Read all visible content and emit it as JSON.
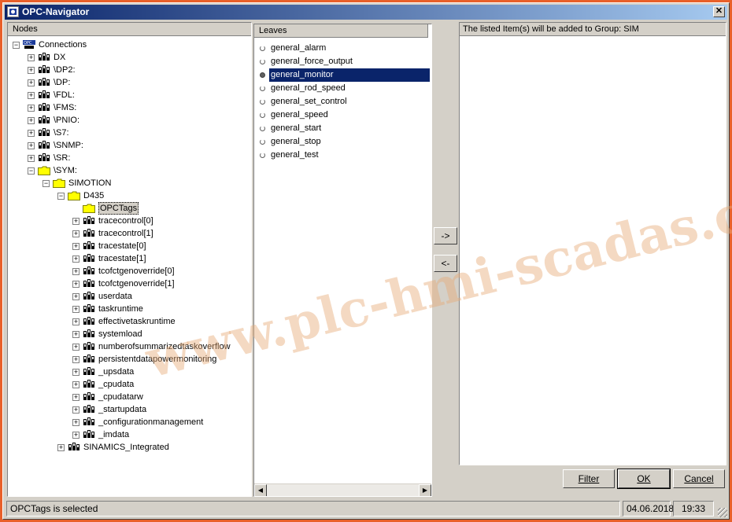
{
  "window": {
    "title": "OPC-Navigator"
  },
  "nodes_panel": {
    "header": "Nodes",
    "tree": [
      {
        "level": 0,
        "expander": "minus",
        "icon": "opc",
        "label": "Connections"
      },
      {
        "level": 1,
        "expander": "plus",
        "icon": "network",
        "label": "DX"
      },
      {
        "level": 1,
        "expander": "plus",
        "icon": "network",
        "label": "\\DP2:"
      },
      {
        "level": 1,
        "expander": "plus",
        "icon": "network",
        "label": "\\DP:"
      },
      {
        "level": 1,
        "expander": "plus",
        "icon": "network",
        "label": "\\FDL:"
      },
      {
        "level": 1,
        "expander": "plus",
        "icon": "network",
        "label": "\\FMS:"
      },
      {
        "level": 1,
        "expander": "plus",
        "icon": "network",
        "label": "\\PNIO:"
      },
      {
        "level": 1,
        "expander": "plus",
        "icon": "network",
        "label": "\\S7:"
      },
      {
        "level": 1,
        "expander": "plus",
        "icon": "network",
        "label": "\\SNMP:"
      },
      {
        "level": 1,
        "expander": "plus",
        "icon": "network",
        "label": "\\SR:"
      },
      {
        "level": 1,
        "expander": "minus",
        "icon": "folder",
        "label": "\\SYM:"
      },
      {
        "level": 2,
        "expander": "minus",
        "icon": "folder",
        "label": "SIMOTION"
      },
      {
        "level": 3,
        "expander": "minus",
        "icon": "folder",
        "label": "D435"
      },
      {
        "level": 4,
        "expander": "none",
        "icon": "folder",
        "label": "OPCTags",
        "selected": true
      },
      {
        "level": 4,
        "expander": "plus",
        "icon": "network",
        "label": "tracecontrol[0]"
      },
      {
        "level": 4,
        "expander": "plus",
        "icon": "network",
        "label": "tracecontrol[1]"
      },
      {
        "level": 4,
        "expander": "plus",
        "icon": "network",
        "label": "tracestate[0]"
      },
      {
        "level": 4,
        "expander": "plus",
        "icon": "network",
        "label": "tracestate[1]"
      },
      {
        "level": 4,
        "expander": "plus",
        "icon": "network",
        "label": "tcofctgenoverride[0]"
      },
      {
        "level": 4,
        "expander": "plus",
        "icon": "network",
        "label": "tcofctgenoverride[1]"
      },
      {
        "level": 4,
        "expander": "plus",
        "icon": "network",
        "label": "userdata"
      },
      {
        "level": 4,
        "expander": "plus",
        "icon": "network",
        "label": "taskruntime"
      },
      {
        "level": 4,
        "expander": "plus",
        "icon": "network",
        "label": "effectivetaskruntime"
      },
      {
        "level": 4,
        "expander": "plus",
        "icon": "network",
        "label": "systemload"
      },
      {
        "level": 4,
        "expander": "plus",
        "icon": "network",
        "label": "numberofsummarizedtaskoverflow"
      },
      {
        "level": 4,
        "expander": "plus",
        "icon": "network",
        "label": "persistentdatapowermonitoring"
      },
      {
        "level": 4,
        "expander": "plus",
        "icon": "network",
        "label": "_upsdata"
      },
      {
        "level": 4,
        "expander": "plus",
        "icon": "network",
        "label": "_cpudata"
      },
      {
        "level": 4,
        "expander": "plus",
        "icon": "network",
        "label": "_cpudatarw"
      },
      {
        "level": 4,
        "expander": "plus",
        "icon": "network",
        "label": "_startupdata"
      },
      {
        "level": 4,
        "expander": "plus",
        "icon": "network",
        "label": "_configurationmanagement"
      },
      {
        "level": 4,
        "expander": "plus",
        "icon": "network",
        "label": "_imdata"
      },
      {
        "level": 3,
        "expander": "plus",
        "icon": "network",
        "label": "SINAMICS_Integrated"
      }
    ]
  },
  "leaves_panel": {
    "header": "Leaves",
    "items": [
      {
        "label": "general_alarm",
        "selected": false
      },
      {
        "label": "general_force_output",
        "selected": false
      },
      {
        "label": "general_monitor",
        "selected": true
      },
      {
        "label": "general_rod_speed",
        "selected": false
      },
      {
        "label": "general_set_control",
        "selected": false
      },
      {
        "label": "general_speed",
        "selected": false
      },
      {
        "label": "general_start",
        "selected": false
      },
      {
        "label": "general_stop",
        "selected": false
      },
      {
        "label": "general_test",
        "selected": false
      }
    ]
  },
  "transfer": {
    "add_label": "->",
    "remove_label": "<-"
  },
  "group_panel": {
    "header": "The listed Item(s) will be added to Group: SIM"
  },
  "buttons": {
    "filter": "Filter",
    "ok": "OK",
    "cancel": "Cancel"
  },
  "status": {
    "message": "OPCTags is selected",
    "date": "04.06.2018",
    "time": "19:33"
  },
  "watermark": "www.plc-hmi-scadas.com",
  "colors": {
    "title_start": "#0a246a",
    "title_end": "#a6caf0",
    "selection": "#0a246a",
    "folder": "#ffff00"
  }
}
